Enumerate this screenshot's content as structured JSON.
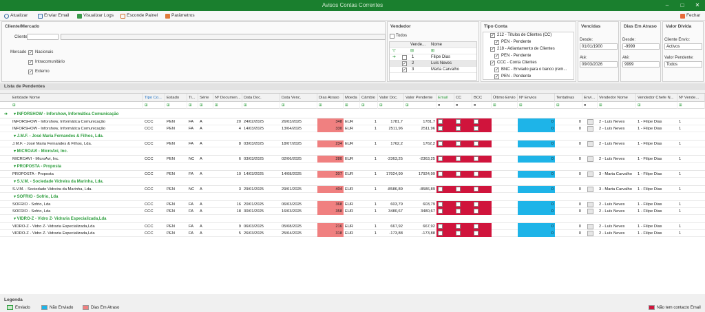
{
  "window": {
    "title": "Avisos Contas Correntes",
    "minimize": "–",
    "maximize": "□",
    "close": "✕"
  },
  "toolbar": {
    "items": [
      {
        "label": "Atualizar",
        "icon": "refresh-icon"
      },
      {
        "label": "Enviar Email",
        "icon": "email-icon"
      },
      {
        "label": "Visualizar Logs",
        "icon": "logs-icon"
      },
      {
        "label": "Esconde Painel",
        "icon": "panel-icon"
      },
      {
        "label": "Parâmetros",
        "icon": "params-icon"
      }
    ],
    "close_label": "Fechar"
  },
  "filters": {
    "cliente": {
      "title": "Cliente/Mercado",
      "cliente_label": "Cliente",
      "mercado_label": "Mercado",
      "mercados": [
        "Nacionais",
        "Intracomunitário",
        "Externo"
      ]
    },
    "vendedor": {
      "title": "Vendedor",
      "todos": "Todos",
      "col1": "Vende...",
      "col2": "Nome",
      "rows": [
        {
          "num": "1",
          "name": "Filipe Dias"
        },
        {
          "num": "2",
          "name": "Luís Neves"
        },
        {
          "num": "3",
          "name": "Marta Carvalho"
        }
      ]
    },
    "tipo": {
      "title": "Tipo Conta",
      "items": [
        "212 - Títulos de Clientes (CC)",
        "PEN - Pendente",
        "218 - Adiantamento de Clientes",
        "PEN - Pendente",
        "CCC - Conta Clientes",
        "BNC - Enviado para o banco (rem...",
        "PEN - Pendente"
      ]
    },
    "vencidas": {
      "title": "Vencidas",
      "desde_label": "Desde:",
      "desde": "01/01/1900",
      "ate_label": "Até:",
      "ate": "09/03/2026"
    },
    "atraso": {
      "title": "Dias Em Atraso",
      "desde_label": "Desde:",
      "desde": "-9999",
      "ate_label": "Até:",
      "ate": "9999"
    },
    "divida": {
      "title": "Valor Dívida",
      "envio_label": "Cliente Envio:",
      "envio": "Activos",
      "pendente_label": "Valor Pendente:",
      "pendente": "Todos"
    }
  },
  "section": {
    "title": "Lista de Pendentes"
  },
  "columns": [
    "Entidade Nome",
    "Tipo Co...",
    "Estado",
    "Ti...",
    "Série",
    "Nº Documen...",
    "Data Doc.",
    "Data Venc.",
    "Dias Atraso",
    "Moeda",
    "Câmbio",
    "Valor Doc.",
    "Valor Pendente",
    "Email",
    "CC",
    "BCC",
    "Último Envio",
    "Nº Envios",
    "Tentativas",
    "Envi...",
    "Vendedor Nome",
    "Vendedor Chefe N...",
    "Nº Vende..."
  ],
  "groups": [
    {
      "title": "INFORSHOW - Inforshow, Informática Comunicação",
      "rows": [
        [
          "INFORSHOW - Inforshow, Informática Comunicação",
          "CCC",
          "PEN",
          "FA",
          "A",
          "20",
          "24/02/2025",
          "26/03/2025",
          "348",
          "EUR",
          "1",
          "1781,7",
          "1781,7",
          "0",
          "0",
          "2 - Luís Neves",
          "1 - Filipe Dias",
          "1"
        ],
        [
          "INFORSHOW - Inforshow, Informática Comunicação",
          "CCC",
          "PEN",
          "FA",
          "A",
          "4",
          "14/03/2025",
          "13/04/2025",
          "330",
          "EUR",
          "1",
          "2511,96",
          "2511,96",
          "0",
          "0",
          "2 - Luís Neves",
          "1 - Filipe Dias",
          "1"
        ]
      ]
    },
    {
      "title": "J.M.F. - José Maria Fernandes & Filhos, Lda.",
      "rows": [
        [
          "J.M.F. - José Maria Fernandes & Filhos, Lda.",
          "CCC",
          "PEN",
          "FA",
          "A",
          "8",
          "03/03/2025",
          "18/07/2025",
          "234",
          "EUR",
          "1",
          "1762,2",
          "1762,2",
          "0",
          "0",
          "2 - Luís Neves",
          "1 - Filipe Dias",
          "1"
        ]
      ]
    },
    {
      "title": "MICROAVI - MicroAvi, Inc.",
      "rows": [
        [
          "MICROAVI - MicroAvi, Inc.",
          "CCC",
          "PEN",
          "NC",
          "A",
          "6",
          "03/03/2025",
          "02/06/2025",
          "280",
          "EUR",
          "1",
          "-2363,25",
          "-2363,25",
          "0",
          "0",
          "2 - Luís Neves",
          "1 - Filipe Dias",
          "1"
        ]
      ]
    },
    {
      "title": "PROPOSTA - Proposta",
      "rows": [
        [
          "PROPOSTA - Proposta",
          "CCC",
          "PEN",
          "FA",
          "A",
          "10",
          "14/03/2025",
          "14/08/2025",
          "207",
          "EUR",
          "1",
          "17924,99",
          "17924,99",
          "0",
          "0",
          "3 - Marta Carvalho",
          "1 - Filipe Dias",
          "1"
        ]
      ]
    },
    {
      "title": "S.V.M. - Sociedade Vidreira da Marinha, Lda.",
      "rows": [
        [
          "S.V.M. - Sociedade Vidreira da Marinha, Lda.",
          "CCC",
          "PEN",
          "NC",
          "A",
          "3",
          "29/01/2025",
          "29/01/2025",
          "404",
          "EUR",
          "1",
          "-8586,89",
          "-8586,89",
          "0",
          "0",
          "3 - Marta Carvalho",
          "1 - Filipe Dias",
          "1"
        ]
      ]
    },
    {
      "title": "SOFRIO - Sofrio, Lda",
      "rows": [
        [
          "SOFRIO - Sofrio, Lda",
          "CCC",
          "PEN",
          "FA",
          "A",
          "16",
          "20/01/2025",
          "06/03/2025",
          "368",
          "EUR",
          "1",
          "603,79",
          "603,79",
          "0",
          "0",
          "2 - Luís Neves",
          "1 - Filipe Dias",
          "1"
        ],
        [
          "SOFRIO - Sofrio, Lda",
          "CCC",
          "PEN",
          "FA",
          "A",
          "18",
          "30/01/2025",
          "16/03/2025",
          "358",
          "EUR",
          "1",
          "3480,67",
          "3480,67",
          "0",
          "0",
          "2 - Luís Neves",
          "1 - Filipe Dias",
          "1"
        ]
      ]
    },
    {
      "title": "VIDRO-Z - Vidro Z- Vidraria Especializada,Lda",
      "rows": [
        [
          "VIDRO-Z - Vidro Z- Vidraria Especializada,Lda",
          "CCC",
          "PEN",
          "FA",
          "A",
          "9",
          "06/03/2025",
          "05/08/2025",
          "216",
          "EUR",
          "1",
          "667,92",
          "667,92",
          "0",
          "0",
          "2 - Luís Neves",
          "1 - Filipe Dias",
          "1"
        ],
        [
          "VIDRO-Z - Vidro Z- Vidraria Especializada,Lda",
          "CCC",
          "PEN",
          "FA",
          "A",
          "5",
          "26/03/2025",
          "25/04/2025",
          "318",
          "EUR",
          "1",
          "-173,88",
          "-173,88",
          "0",
          "0",
          "2 - Luís Neves",
          "1 - Filipe Dias",
          "1"
        ]
      ]
    }
  ],
  "legend": {
    "title": "Legenda",
    "enviado": "Enviado",
    "nao_enviado": "Não Enviado",
    "dias_atraso": "Dias Em Atraso",
    "sem_contacto": "Não tem contacto Email"
  },
  "colors": {
    "title_bar": "#1a7f2e",
    "group_text": "#2e9e3e",
    "atraso": "#f08080",
    "envios": "#1eb4e8",
    "email_missing": "#d0143c"
  }
}
